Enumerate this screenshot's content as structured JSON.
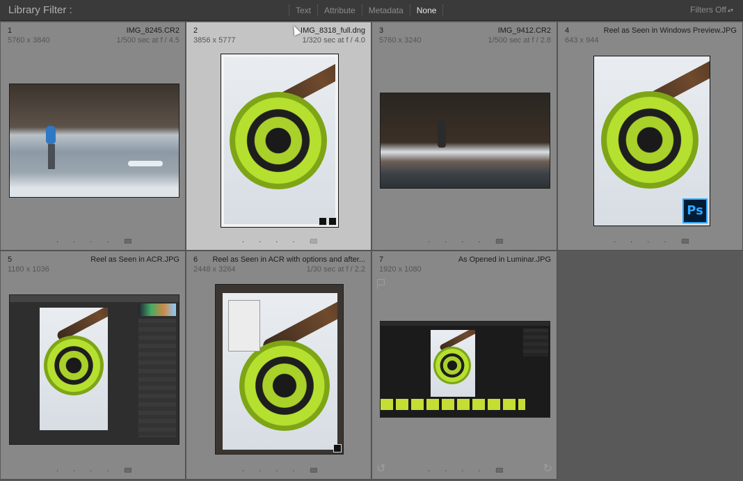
{
  "filter_bar": {
    "title": "Library Filter :",
    "modes": [
      "Text",
      "Attribute",
      "Metadata",
      "None"
    ],
    "active_mode": "None",
    "filters_off": "Filters Off"
  },
  "cells": [
    {
      "index": "1",
      "name": "IMG_8245.CR2",
      "dims": "5760 x 3840",
      "exif": "1/500 sec at f / 4.5"
    },
    {
      "index": "2",
      "name": "IMG_8318_full.dng",
      "dims": "3856 x 5777",
      "exif": "1/320 sec at f / 4.0"
    },
    {
      "index": "3",
      "name": "IMG_9412.CR2",
      "dims": "5760 x 3240",
      "exif": "1/500 sec at f / 2.8"
    },
    {
      "index": "4",
      "name": "Reel as Seen in Windows Preview.JPG",
      "dims": "643 x 944",
      "exif": ""
    },
    {
      "index": "5",
      "name": "Reel as Seen in ACR.JPG",
      "dims": "1180 x 1036",
      "exif": ""
    },
    {
      "index": "6",
      "name": "Reel as Seen in ACR with options and after...",
      "dims": "2448 x 3264",
      "exif": "1/30 sec at f / 2.2"
    },
    {
      "index": "7",
      "name": "As Opened in Luminar.JPG",
      "dims": "1920 x 1080",
      "exif": ""
    }
  ],
  "rating_dots": ". . . . .",
  "badges": {
    "photoshop": "Ps"
  },
  "icons": {
    "cursor": "mouse-pointer-icon",
    "flag": "pick-flag-icon",
    "rotate_left": "rotate-left-icon",
    "rotate_right": "rotate-right-icon"
  },
  "colors": {
    "selected_cell": "#c4c4c4",
    "cell": "#888888",
    "background": "#595959"
  }
}
